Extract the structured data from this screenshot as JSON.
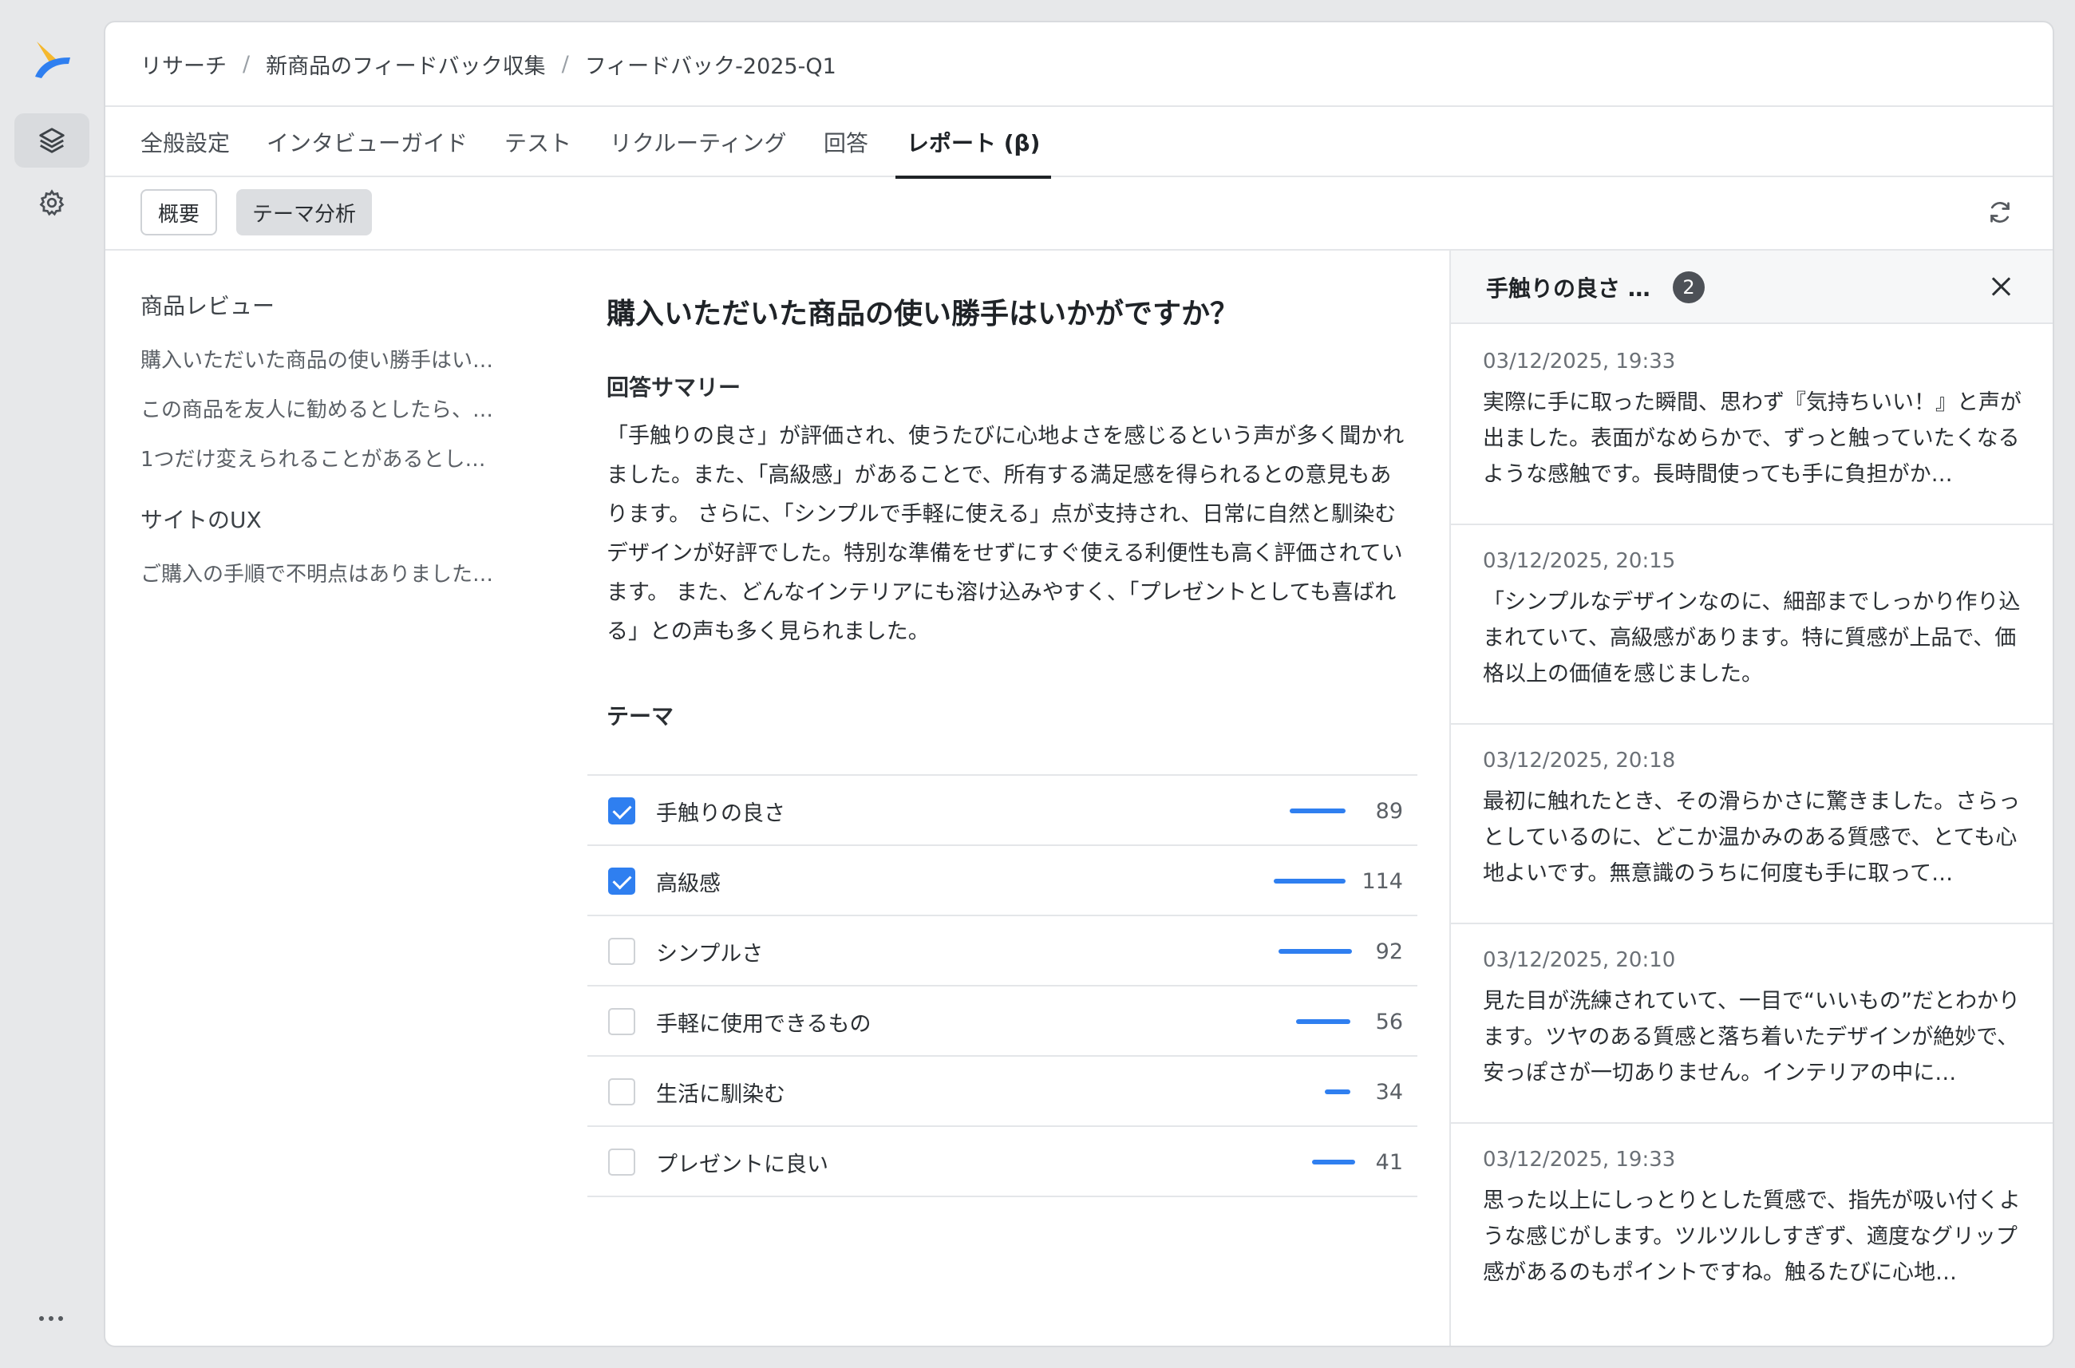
{
  "breadcrumb": {
    "items": [
      "リサーチ",
      "新商品のフィードバック収集",
      "フィードバック-2025-Q1"
    ],
    "separator": "/"
  },
  "tabs": [
    {
      "label": "全般設定"
    },
    {
      "label": "インタビューガイド"
    },
    {
      "label": "テスト"
    },
    {
      "label": "リクルーティング"
    },
    {
      "label": "回答"
    },
    {
      "label": "レポート (β)",
      "active": true
    }
  ],
  "view_toggle": {
    "overview_label": "概要",
    "theme_label": "テーマ分析",
    "selected": "テーマ分析"
  },
  "questions": {
    "groups": [
      {
        "title": "商品レビュー",
        "items": [
          "購入いただいた商品の使い勝手はい…",
          "この商品を友人に勧めるとしたら、…",
          "1つだけ変えられることがあるとし…"
        ]
      },
      {
        "title": "サイトのUX",
        "items": [
          "ご購入の手順で不明点はありました…"
        ]
      }
    ]
  },
  "main": {
    "question_title": "購入いただいた商品の使い勝手はいかがですか？",
    "summary_label": "回答サマリー",
    "summary_text": "「手触りの良さ」が評価され、使うたびに心地よさを感じるという声が多く聞かれました。また、「高級感」があることで、所有する満足感を得られるとの意見もあります。 さらに、「シンプルで手軽に使える」点が支持され、日常に自然と馴染むデザインが好評でした。特別な準備をせずにすぐ使える利便性も高く評価されています。 また、どんなインテリアにも溶け込みやすく、「プレゼントとしても喜ばれる」との声も多く見られました。",
    "theme_label": "テーマ",
    "themes": [
      {
        "name": "手触りの良さ",
        "count": "89",
        "checked": true
      },
      {
        "name": "高級感",
        "count": "114",
        "checked": true
      },
      {
        "name": "シンプルさ",
        "count": "92",
        "checked": false
      },
      {
        "name": "手軽に使用できるもの",
        "count": "56",
        "checked": false
      },
      {
        "name": "生活に馴染む",
        "count": "34",
        "checked": false
      },
      {
        "name": "プレゼントに良い",
        "count": "41",
        "checked": false
      }
    ]
  },
  "side_panel": {
    "title": "手触りの良さ …",
    "badge": "2",
    "responses": [
      {
        "date": "03/12/2025, 19:33",
        "text": "実際に手に取った瞬間、思わず『気持ちいい！』と声が出ました。表面がなめらかで、ずっと触っていたくなるような感触です。長時間使っても手に負担がか…"
      },
      {
        "date": "03/12/2025, 20:15",
        "text": "「シンプルなデザインなのに、細部までしっかり作り込まれていて、高級感があります。特に質感が上品で、価格以上の価値を感じました。"
      },
      {
        "date": "03/12/2025, 20:18",
        "text": "最初に触れたとき、その滑らかさに驚きました。さらっとしているのに、どこか温かみのある質感で、とても心地よいです。無意識のうちに何度も手に取って…"
      },
      {
        "date": "03/12/2025, 20:10",
        "text": "見た目が洗練されていて、一目で“いいもの”だとわかります。ツヤのある質感と落ち着いたデザインが絶妙で、安っぽさが一切ありません。インテリアの中に…"
      },
      {
        "date": "03/12/2025, 19:33",
        "text": "思った以上にしっとりとした質感で、指先が吸い付くような感じがします。ツルツルしすぎず、適度なグリップ感があるのもポイントですね。触るたびに心地…"
      }
    ]
  },
  "colors": {
    "accent": "#2f7ff0",
    "logo_yellow": "#f5b82e",
    "logo_blue": "#2f7ff0"
  },
  "icons": {
    "logo": "app-logo",
    "layers": "layers-icon",
    "settings": "gear-icon",
    "more": "more-icon",
    "refresh": "refresh-icon",
    "close": "close-icon"
  }
}
